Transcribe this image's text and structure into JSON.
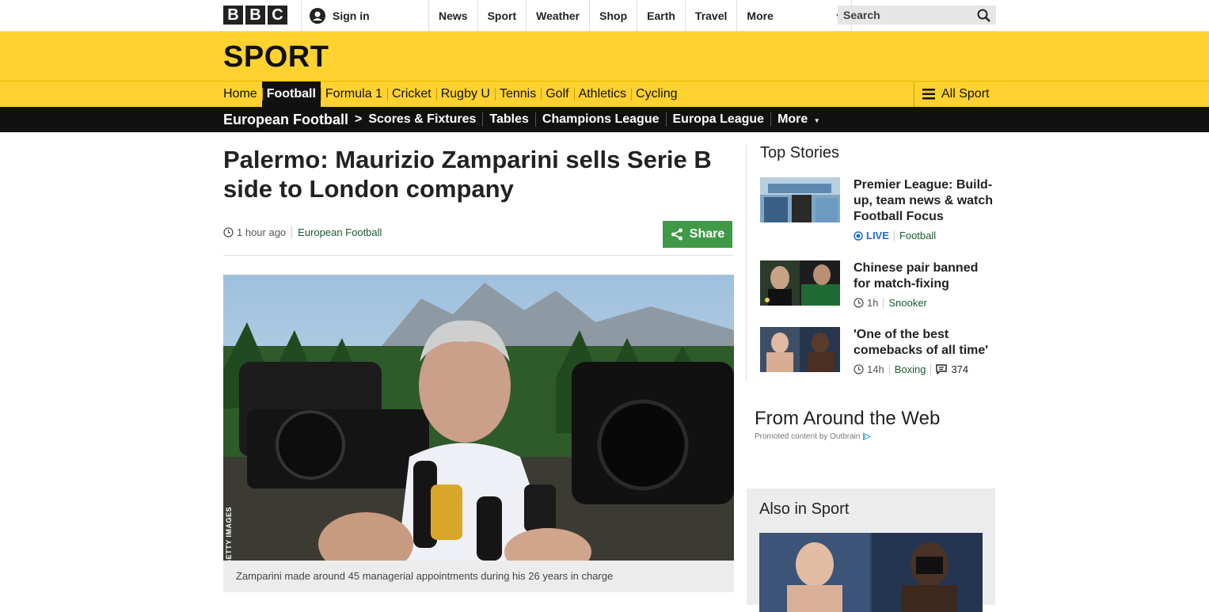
{
  "global_nav": {
    "logo_letters": [
      "B",
      "B",
      "C"
    ],
    "sign_in": "Sign in",
    "items": [
      "News",
      "Sport",
      "Weather",
      "Shop",
      "Earth",
      "Travel"
    ],
    "more": "More",
    "search_placeholder": "Search"
  },
  "sport_header": {
    "title": "SPORT",
    "nav": [
      "Home",
      "Football",
      "Formula 1",
      "Cricket",
      "Rugby U",
      "Tennis",
      "Golf",
      "Athletics",
      "Cycling"
    ],
    "active": "Football",
    "all_sport": "All Sport"
  },
  "sub_nav": {
    "section": "European Football",
    "items": [
      "Scores & Fixtures",
      "Tables",
      "Champions League",
      "Europa League",
      "More"
    ]
  },
  "article": {
    "headline": "Palermo: Maurizio Zamparini sells Serie B side to London company",
    "time": "1 hour ago",
    "section": "European Football",
    "share": "Share",
    "image_credit": "GETTY IMAGES",
    "caption": "Zamparini made around 45 managerial appointments during his 26 years in charge"
  },
  "top_stories": {
    "title": "Top Stories",
    "stories": [
      {
        "title": "Premier League: Build-up, team news & watch Football Focus",
        "live": "LIVE",
        "section": "Football"
      },
      {
        "title": "Chinese pair banned for match-fixing",
        "time": "1h",
        "section": "Snooker"
      },
      {
        "title": "'One of the best comebacks of all time'",
        "time": "14h",
        "section": "Boxing",
        "comments": "374"
      }
    ]
  },
  "from_web": {
    "title": "From Around the Web",
    "promoted": "Promoted content by Outbrain",
    "ob_mark": "|▷"
  },
  "also_in_sport": {
    "title": "Also in Sport"
  },
  "colors": {
    "sport_yellow": "#ffd230",
    "share_green": "#3f9a48",
    "link_green": "#1a5a2e",
    "live_blue": "#1e6bd0"
  }
}
